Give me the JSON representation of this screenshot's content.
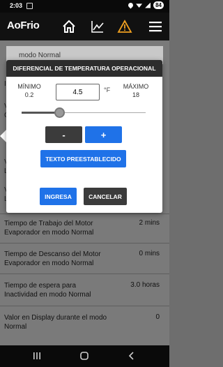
{
  "status_bar": {
    "time": "2:03",
    "battery": "84"
  },
  "navbar": {
    "logo": "AoFrio",
    "icons": [
      "home-icon",
      "chart-icon",
      "warning-icon",
      "menu-icon"
    ],
    "warning_color": "#f0a020"
  },
  "settings": {
    "section_title": "modo Normal",
    "rows": [
      {
        "label": "Tiempo de Trabajo del Motor Evaporador en modo Normal",
        "value": "2 mins"
      },
      {
        "label": "Tiempo de Descanso del Motor Evaporador en modo Normal",
        "value": "0 mins"
      },
      {
        "label": "Tiempo de espera para Inactividad en modo Normal",
        "value": "3.0 horas"
      },
      {
        "label": "Valor en Display durante el modo Normal",
        "value": "0"
      }
    ]
  },
  "modal": {
    "title": "DIFERENCIAL DE TEMPERATURA OPERACIONAL",
    "min_label": "MÍNIMO",
    "min_value": "0.2",
    "max_label": "MÁXIMO",
    "max_value": "18",
    "current_value": "4.5",
    "unit": "°F",
    "slider": {
      "min": 0.2,
      "max": 18,
      "value": 4.5
    },
    "minus_label": "-",
    "plus_label": "+",
    "preset_label": "TEXTO PREESTABLECIDO",
    "submit_label": "INGRESA",
    "cancel_label": "CANCELAR",
    "accent_color": "#1f72e8"
  }
}
